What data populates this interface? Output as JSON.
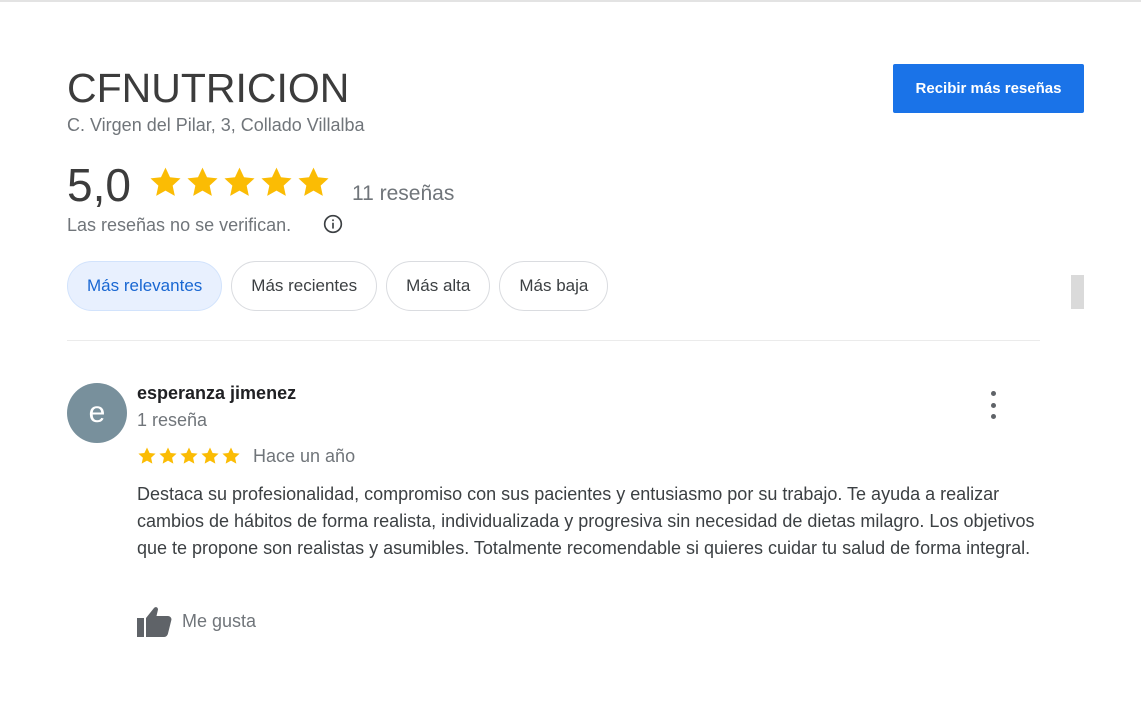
{
  "business": {
    "name": "CFNUTRICION",
    "address": "C. Virgen del Pilar, 3, Collado Villalba"
  },
  "cta": {
    "label": "Recibir más reseñas",
    "color": "#1a73e8"
  },
  "summary": {
    "rating": "5,0",
    "stars": 5,
    "count_label": "11 reseñas",
    "notice": "Las reseñas no se verifican.",
    "star_color": "#fbbc04",
    "info_icon": "info-icon"
  },
  "sort_chips": [
    {
      "label": "Más relevantes",
      "active": true
    },
    {
      "label": "Más recientes",
      "active": false
    },
    {
      "label": "Más alta",
      "active": false
    },
    {
      "label": "Más baja",
      "active": false
    }
  ],
  "reviews": [
    {
      "avatar_letter": "e",
      "avatar_color": "#78909c",
      "author": "esperanza jimenez",
      "author_reviews": "1 reseña",
      "stars": 5,
      "time": "Hace un año",
      "text": "Destaca su profesionalidad, compromiso con sus pacientes y entusiasmo por su trabajo. Te ayuda a realizar cambios de hábitos de forma realista, individualizada y progresiva sin necesidad de dietas milagro. Los objetivos que te propone son realistas y asumibles. Totalmente recomendable si quieres cuidar tu salud de forma integral.",
      "like_label": "Me gusta",
      "like_icon": "thumbs-up-icon",
      "menu_icon": "more-vert-icon"
    }
  ]
}
